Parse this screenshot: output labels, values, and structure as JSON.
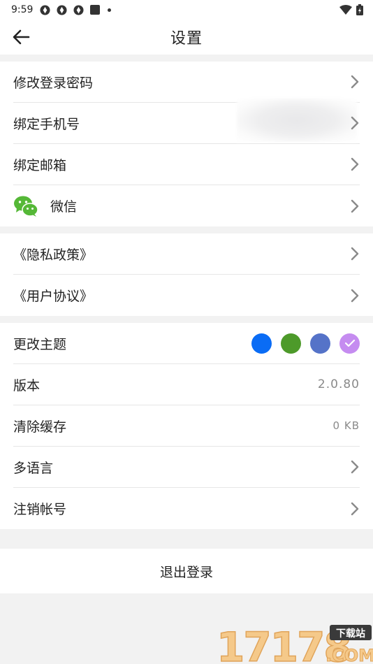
{
  "status_bar": {
    "time": "9:59",
    "icons": [
      "app-notification-icon",
      "app-notification-icon",
      "app-notification-icon",
      "square-app-icon",
      "dot-icon",
      "wifi-icon",
      "battery-icon"
    ]
  },
  "header": {
    "title": "设置",
    "back_icon": "arrow-left-icon"
  },
  "account_group": [
    {
      "label": "修改登录密码"
    },
    {
      "label": "绑定手机号"
    },
    {
      "label": "绑定邮箱"
    },
    {
      "label": "微信",
      "icon": "wechat-icon"
    }
  ],
  "legal_group": [
    {
      "label": "《隐私政策》"
    },
    {
      "label": "《用户协议》"
    }
  ],
  "settings_group": {
    "theme": {
      "label": "更改主题",
      "colors": [
        "#0a6cf5",
        "#4d9a2a",
        "#5573c8",
        "#c58cf0"
      ],
      "selected_index": 3
    },
    "version": {
      "label": "版本",
      "value": "2.0.80"
    },
    "cache": {
      "label": "清除缓存",
      "value": "0 KB"
    },
    "language": {
      "label": "多语言"
    },
    "delete_account": {
      "label": "注销帐号"
    }
  },
  "logout": {
    "label": "退出登录"
  },
  "watermark": {
    "text": "17178",
    "badge": "下载站",
    "suffix": ".COM"
  }
}
